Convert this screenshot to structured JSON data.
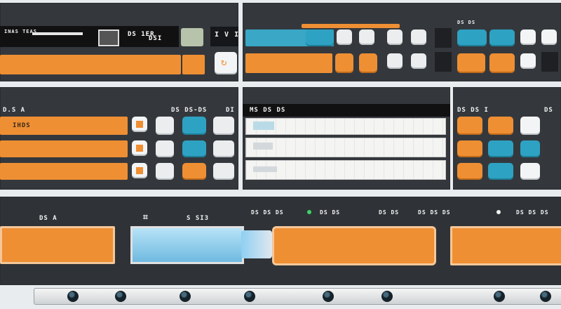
{
  "top_left": {
    "header_label": "INAS TEAS",
    "header_readout": "DS 1ER",
    "side_code": "I V I O"
  },
  "mid_left": {
    "header_left": "D.S A",
    "header_right": "DS DS-DS",
    "header_far": "DI",
    "row_label": "IHDS"
  },
  "mid_center": {
    "header_label": "MS DS DS"
  },
  "mid_right": {
    "header_label": "DS DS I"
  },
  "bottom": {
    "label_left": "DS A",
    "label_mid": "S SI3",
    "label_center_a": "DS DS DS",
    "label_center_b": "DS DS",
    "label_center_c": "DS DS",
    "label_right_a": "DS DS DS",
    "label_right_b": "DS DS DS"
  },
  "colors": {
    "panel": "#34383d",
    "orange": "#ef8f33",
    "teal": "#39a7c5",
    "light_blue": "#8fd0f2",
    "key_white": "#ecedee",
    "status_green": "#3dd26a"
  },
  "icons": {
    "status": "green-status-light",
    "indicator": "white-indicator-light",
    "roller": "conveyor-roller"
  }
}
